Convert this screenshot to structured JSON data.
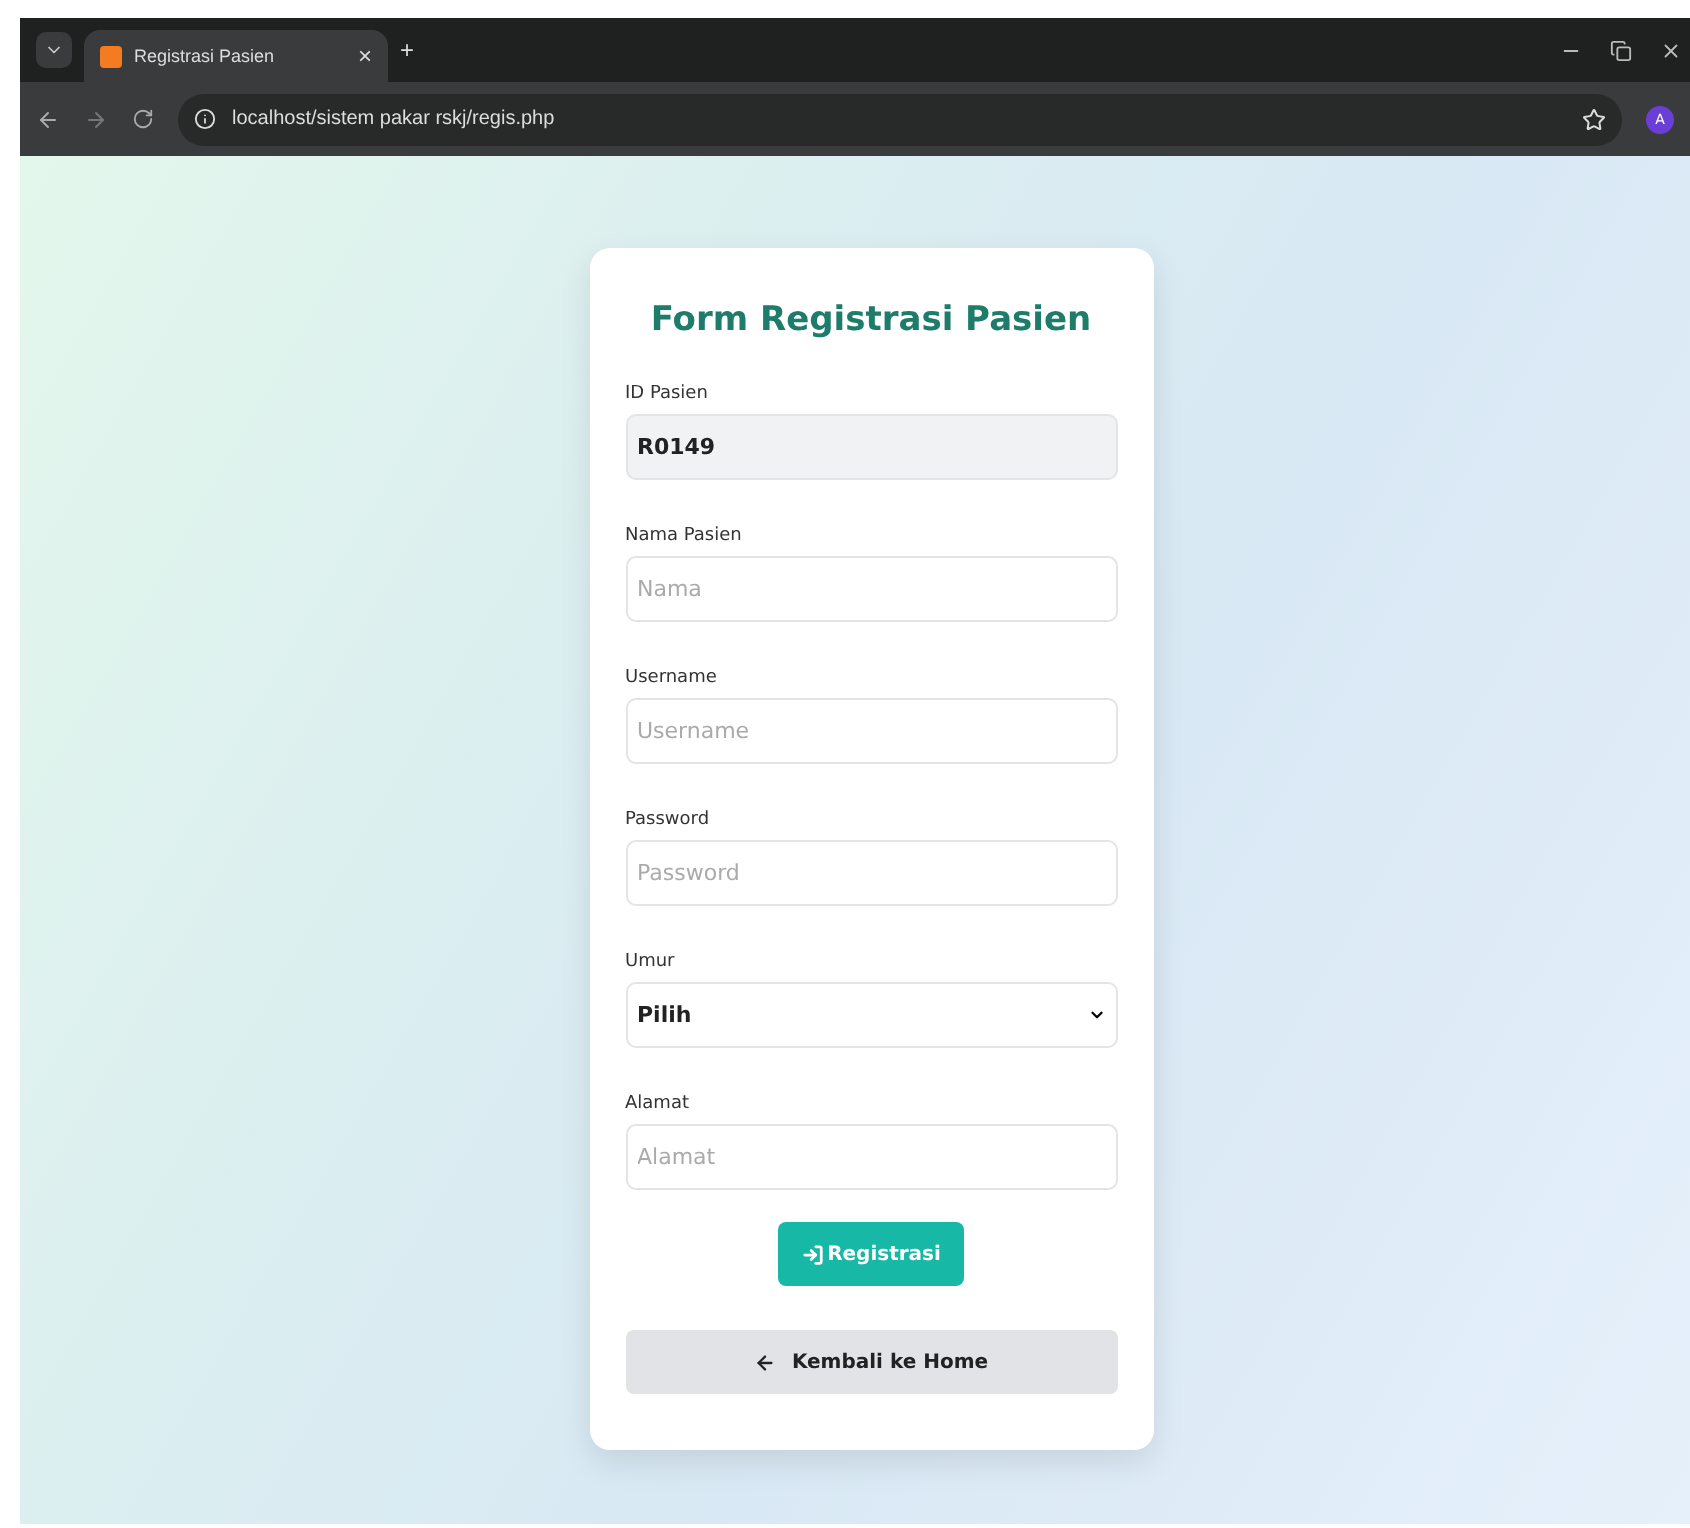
{
  "browser": {
    "tab_title": "Registrasi Pasien",
    "tab_close": "×",
    "new_tab": "+",
    "url": "localhost/sistem pakar rskj/regis.php",
    "profile": "A"
  },
  "form": {
    "title": "Form Registrasi Pasien",
    "fields": [
      {
        "label": "ID Pasien",
        "kind": "text",
        "value": "R0149",
        "readonly": true
      },
      {
        "label": "Nama Pasien",
        "kind": "text",
        "placeholder": "Nama",
        "readonly": false
      },
      {
        "label": "Username",
        "kind": "text",
        "placeholder": "Username",
        "readonly": false
      },
      {
        "label": "Password",
        "kind": "text",
        "placeholder": "Password",
        "readonly": false
      },
      {
        "label": "Umur",
        "kind": "select",
        "value": "Pilih",
        "readonly": false
      },
      {
        "label": "Alamat",
        "kind": "text",
        "placeholder": "Alamat",
        "readonly": false
      }
    ],
    "submit": "Registrasi",
    "back": "Kembali ke Home"
  }
}
